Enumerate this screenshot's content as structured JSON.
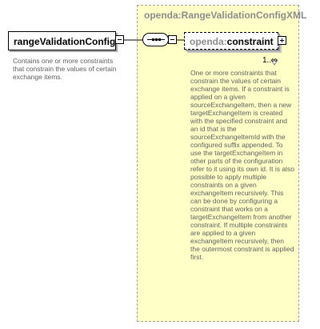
{
  "type_box": {
    "title": "openda:RangeValidationConfigXML"
  },
  "root_element": {
    "name": "rangeValidationConfig",
    "description": "Contains one or more constraints that constrain the values of certain exchange items."
  },
  "child_element": {
    "prefix": "openda:",
    "name": "constraint",
    "cardinality": "1..∞",
    "description": "One or more constraints that constrain the values of certain exchange items. If a constraint is applied on a given sourceExchangeItem, then a new targetExchangeItem is created with the specified constraint and an id that is the sourceExchangeItemId with the configured suffix appended. To use the targetExchangeItem in other parts of the configuration refer to it using its own id. It is also possible to apply multiple constraints on a given exchangeItem recursively. This can be done by configuring a constraint that works on a targetExchangeItem from another constraint. If multiple constraints are applied to a given exchangeItem recursively, then the outermost constraint is applied first."
  },
  "colors": {
    "type_box_fill": "#ffffc8",
    "muted_text": "#8c8c8c",
    "description_text": "#606060"
  }
}
